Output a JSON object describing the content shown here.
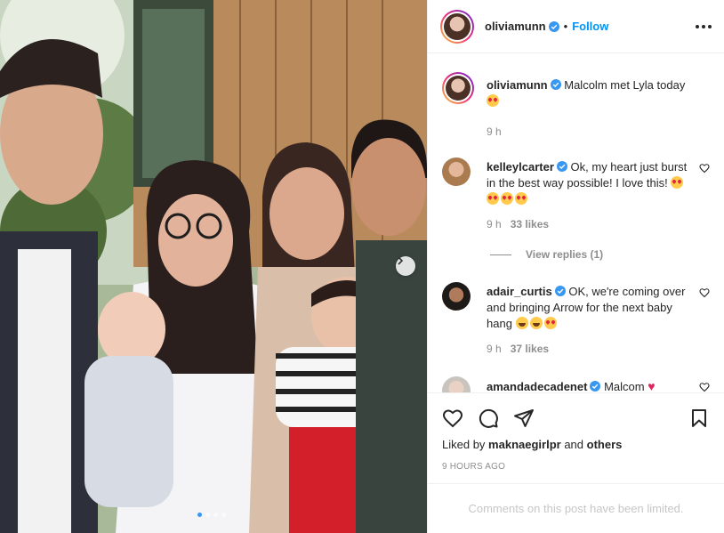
{
  "post": {
    "username": "oliviamunn",
    "follow_label": "Follow",
    "separator": "•",
    "carousel_total": 4,
    "carousel_active": 0
  },
  "caption": {
    "username": "oliviamunn",
    "text": "Malcolm met Lyla today",
    "time": "9 h"
  },
  "comments": [
    {
      "username": "kelleylcarter",
      "text": "Ok, my heart just burst in the best way possible! I love this!",
      "time": "9 h",
      "likes": "33 likes",
      "view_replies": "View replies (1)"
    },
    {
      "username": "adair_curtis",
      "text": "OK, we're coming over and bringing Arrow for the next baby hang",
      "time": "9 h",
      "likes": "37 likes"
    },
    {
      "username": "amandadecadenet",
      "text": "Malcom"
    }
  ],
  "likes": {
    "prefix": "Liked by",
    "user": "maknaegirlpr",
    "and": "and",
    "others": "others"
  },
  "timestamp": "9 HOURS AGO",
  "limited_notice": "Comments on this post have been limited.",
  "icons": {
    "like": "heart-icon",
    "comment": "comment-icon",
    "share": "send-icon",
    "save": "bookmark-icon",
    "more": "more-options-icon",
    "verified": "verified-badge-icon",
    "next": "chevron-right-icon"
  },
  "colors": {
    "link": "#0095f6",
    "verified": "#3897f0",
    "muted": "#8e8e8e",
    "border": "#efefef"
  }
}
